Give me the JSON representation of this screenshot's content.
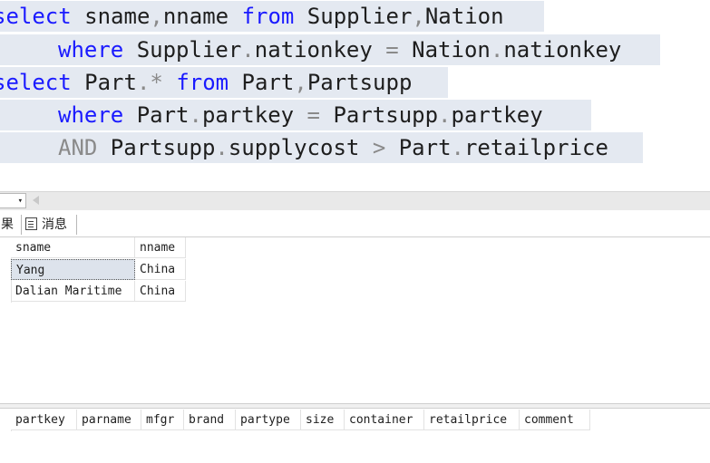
{
  "editor": {
    "lines": [
      [
        {
          "t": "select",
          "c": "kw"
        },
        {
          "t": " sname",
          "c": ""
        },
        {
          "t": ",",
          "c": "op"
        },
        {
          "t": "nname ",
          "c": ""
        },
        {
          "t": "from",
          "c": "kw"
        },
        {
          "t": " Supplier",
          "c": ""
        },
        {
          "t": ",",
          "c": "op"
        },
        {
          "t": "Nation",
          "c": ""
        }
      ],
      [
        {
          "t": "where",
          "c": "kw"
        },
        {
          "t": " Supplier",
          "c": ""
        },
        {
          "t": ".",
          "c": "op"
        },
        {
          "t": "nationkey ",
          "c": ""
        },
        {
          "t": "=",
          "c": "op"
        },
        {
          "t": " Nation",
          "c": ""
        },
        {
          "t": ".",
          "c": "op"
        },
        {
          "t": "nationkey",
          "c": ""
        }
      ],
      [
        {
          "t": "select",
          "c": "kw"
        },
        {
          "t": " Part",
          "c": ""
        },
        {
          "t": ".*",
          "c": "op"
        },
        {
          "t": " ",
          "c": ""
        },
        {
          "t": "from",
          "c": "kw"
        },
        {
          "t": " Part",
          "c": ""
        },
        {
          "t": ",",
          "c": "op"
        },
        {
          "t": "Partsupp",
          "c": ""
        }
      ],
      [
        {
          "t": "where",
          "c": "kw"
        },
        {
          "t": " Part",
          "c": ""
        },
        {
          "t": ".",
          "c": "op"
        },
        {
          "t": "partkey ",
          "c": ""
        },
        {
          "t": "=",
          "c": "op"
        },
        {
          "t": " Partsupp",
          "c": ""
        },
        {
          "t": ".",
          "c": "op"
        },
        {
          "t": "partkey",
          "c": ""
        }
      ],
      [
        {
          "t": "AND",
          "c": "op"
        },
        {
          "t": " Partsupp",
          "c": ""
        },
        {
          "t": ".",
          "c": "op"
        },
        {
          "t": "supplycost ",
          "c": ""
        },
        {
          "t": ">",
          "c": "op"
        },
        {
          "t": " Part",
          "c": ""
        },
        {
          "t": ".",
          "c": "op"
        },
        {
          "t": "retailprice",
          "c": ""
        }
      ]
    ]
  },
  "zoom": {
    "arrow": "▾"
  },
  "tabs": {
    "results": "果",
    "messages": "消息"
  },
  "grid1": {
    "columns": [
      "sname",
      "nname"
    ],
    "rows": [
      [
        "Yang",
        "China"
      ],
      [
        "Dalian Maritime",
        "China"
      ]
    ]
  },
  "grid2": {
    "columns": [
      "partkey",
      "parname",
      "mfgr",
      "brand",
      "partype",
      "size",
      "container",
      "retailprice",
      "comment"
    ]
  }
}
